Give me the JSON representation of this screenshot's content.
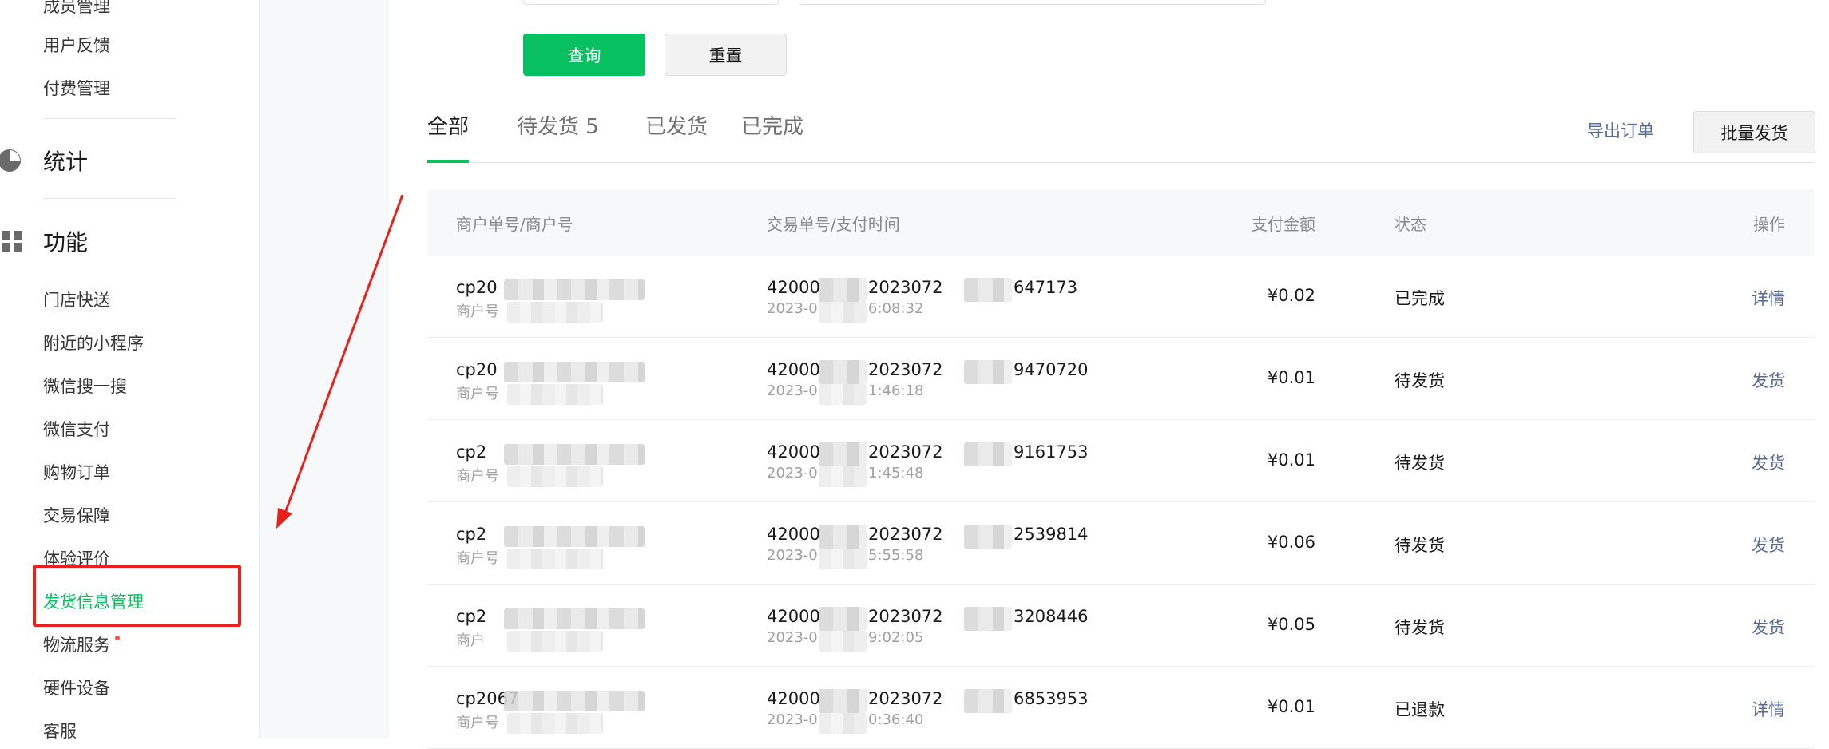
{
  "sidebar": {
    "items_top": [
      "成员管理",
      "用户反馈",
      "付费管理"
    ],
    "sections": [
      {
        "icon": "pie-chart-icon",
        "title": "统计"
      },
      {
        "icon": "grid-icon",
        "title": "功能"
      }
    ],
    "function_items": [
      "门店快送",
      "附近的小程序",
      "微信搜一搜",
      "微信支付",
      "购物订单",
      "交易保障",
      "体验评价",
      "发货信息管理",
      "物流服务",
      "硬件设备",
      "客服"
    ]
  },
  "filters": {
    "query_label": "查询",
    "reset_label": "重置"
  },
  "tabs": [
    {
      "label": "全部"
    },
    {
      "label": "待发货 5"
    },
    {
      "label": "已发货"
    },
    {
      "label": "已完成"
    }
  ],
  "toolbar": {
    "export_label": "导出订单",
    "batch_label": "批量发货"
  },
  "table": {
    "headers": {
      "merchant": "商户单号/商户号",
      "transaction": "交易单号/支付时间",
      "amount": "支付金额",
      "status": "状态",
      "action": "操作"
    },
    "rows": [
      {
        "merchant_no": "cp20",
        "merchant_sub": "商户号",
        "txn_prefix": "42000",
        "txn_mid": "2023072",
        "txn_suffix": "647173",
        "time_prefix": "2023-0",
        "time_suffix": "6:08:32",
        "amount": "¥0.02",
        "status": "已完成",
        "action": "详情"
      },
      {
        "merchant_no": "cp20",
        "merchant_sub": "商户号",
        "txn_prefix": "42000",
        "txn_mid": "2023072",
        "txn_suffix": "9470720",
        "time_prefix": "2023-0",
        "time_suffix": "1:46:18",
        "amount": "¥0.01",
        "status": "待发货",
        "action": "发货"
      },
      {
        "merchant_no": "cp2",
        "merchant_sub": "商户号",
        "txn_prefix": "42000",
        "txn_mid": "2023072",
        "txn_suffix": "9161753",
        "time_prefix": "2023-0",
        "time_suffix": "1:45:48",
        "amount": "¥0.01",
        "status": "待发货",
        "action": "发货"
      },
      {
        "merchant_no": "cp2",
        "merchant_sub": "商户号",
        "txn_prefix": "42000",
        "txn_mid": "2023072",
        "txn_suffix": "2539814",
        "time_prefix": "2023-0",
        "time_suffix": "5:55:58",
        "amount": "¥0.06",
        "status": "待发货",
        "action": "发货"
      },
      {
        "merchant_no": "cp2",
        "merchant_sub": "商户",
        "txn_prefix": "42000",
        "txn_mid": "2023072",
        "txn_suffix": "3208446",
        "time_prefix": "2023-0",
        "time_suffix": "9:02:05",
        "amount": "¥0.05",
        "status": "待发货",
        "action": "发货"
      },
      {
        "merchant_no": "cp2067",
        "merchant_sub": "商户号",
        "txn_prefix": "42000",
        "txn_mid": "2023072",
        "txn_suffix": "6853953",
        "time_prefix": "2023-0",
        "time_suffix": "0:36:40",
        "amount": "¥0.01",
        "status": "已退款",
        "action": "详情"
      }
    ]
  },
  "colors": {
    "primary": "#07c160",
    "link": "#576b95",
    "annotation": "#e8221b"
  }
}
